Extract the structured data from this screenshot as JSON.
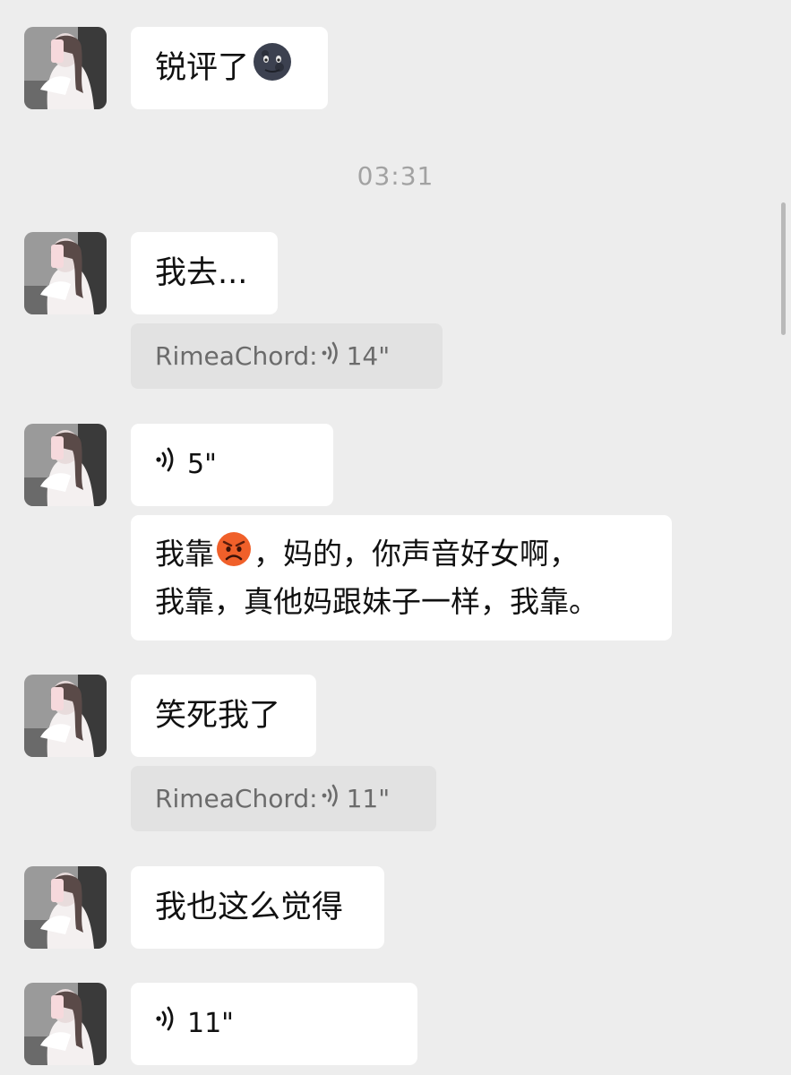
{
  "timestamp": "03:31",
  "messages": [
    {
      "id": "m1",
      "text": "锐评了",
      "emoji": "new-moon-face-emoji"
    },
    {
      "id": "m2",
      "text": "我去..."
    },
    {
      "id": "q1",
      "quote_sender": "RimeaChord:",
      "quote_duration": "14\""
    },
    {
      "id": "m3",
      "voice_duration": "5\""
    },
    {
      "id": "m4",
      "line1_a": "我靠",
      "line1_b": "，妈的，你声音好女啊，",
      "line2": "我靠，真他妈跟妹子一样，我靠。",
      "emoji": "angry-face-emoji"
    },
    {
      "id": "m5",
      "text": "笑死我了"
    },
    {
      "id": "q2",
      "quote_sender": "RimeaChord:",
      "quote_duration": "11\""
    },
    {
      "id": "m6",
      "text": "我也这么觉得"
    },
    {
      "id": "m7",
      "voice_duration": "11\""
    }
  ],
  "icons": {
    "voice": "voice-wave-icon",
    "avatar": "user-avatar"
  },
  "colors": {
    "background": "#ededed",
    "bubble": "#ffffff",
    "quote": "#e2e2e2",
    "timestamp": "#a2a2a2"
  }
}
